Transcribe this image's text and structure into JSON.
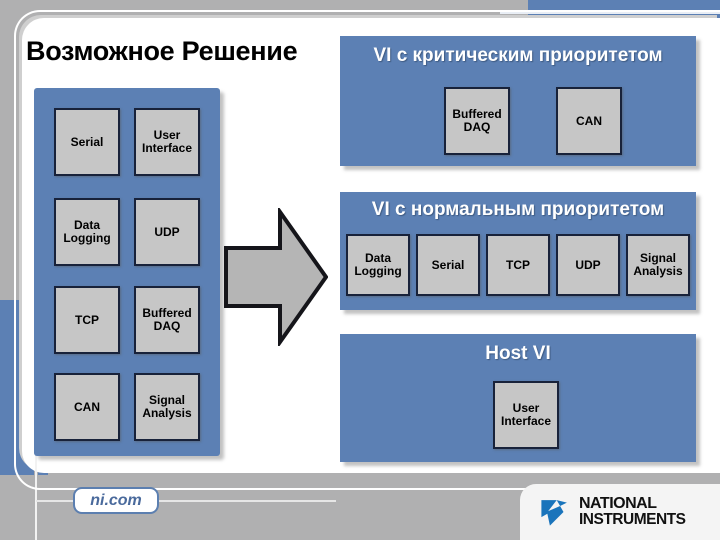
{
  "slide": {
    "title": "Возможное Решение",
    "background_color": "#b0b0b1",
    "panel_color": "#5c80b4",
    "module_color": "#c6c6c6"
  },
  "left_panel": {
    "name": "unscheduled-modules",
    "modules": [
      {
        "label": "Serial"
      },
      {
        "label": "User\nInterface",
        "line1": "User",
        "line2": "Interface"
      },
      {
        "label": "Data\nLogging",
        "line1": "Data",
        "line2": "Logging"
      },
      {
        "label": "UDP"
      },
      {
        "label": "TCP"
      },
      {
        "label": "Buffered\nDAQ",
        "line1": "Buffered",
        "line2": "DAQ"
      },
      {
        "label": "CAN"
      },
      {
        "label": "Signal\nAnalysis",
        "line1": "Signal",
        "line2": "Analysis"
      }
    ]
  },
  "arrow": {
    "name": "flow-arrow",
    "direction": "right",
    "color": "#b5b5b5"
  },
  "critical_panel": {
    "title": "VI с критическим приоритетом",
    "modules": [
      {
        "line1": "Buffered",
        "line2": "DAQ"
      },
      {
        "line1": "CAN",
        "line2": ""
      }
    ]
  },
  "normal_panel": {
    "title": "VI с нормальным приоритетом",
    "modules": [
      {
        "line1": "Data",
        "line2": "Logging"
      },
      {
        "line1": "Serial",
        "line2": ""
      },
      {
        "line1": "TCP",
        "line2": ""
      },
      {
        "line1": "UDP",
        "line2": ""
      },
      {
        "line1": "Signal",
        "line2": "Analysis"
      }
    ]
  },
  "host_panel": {
    "title": "Host VI",
    "modules": [
      {
        "line1": "User",
        "line2": "Interface"
      }
    ]
  },
  "footer": {
    "site": "ni.com",
    "logo_line1": "NATIONAL",
    "logo_line2": "INSTRUMENTS",
    "logo_tm": "®"
  }
}
